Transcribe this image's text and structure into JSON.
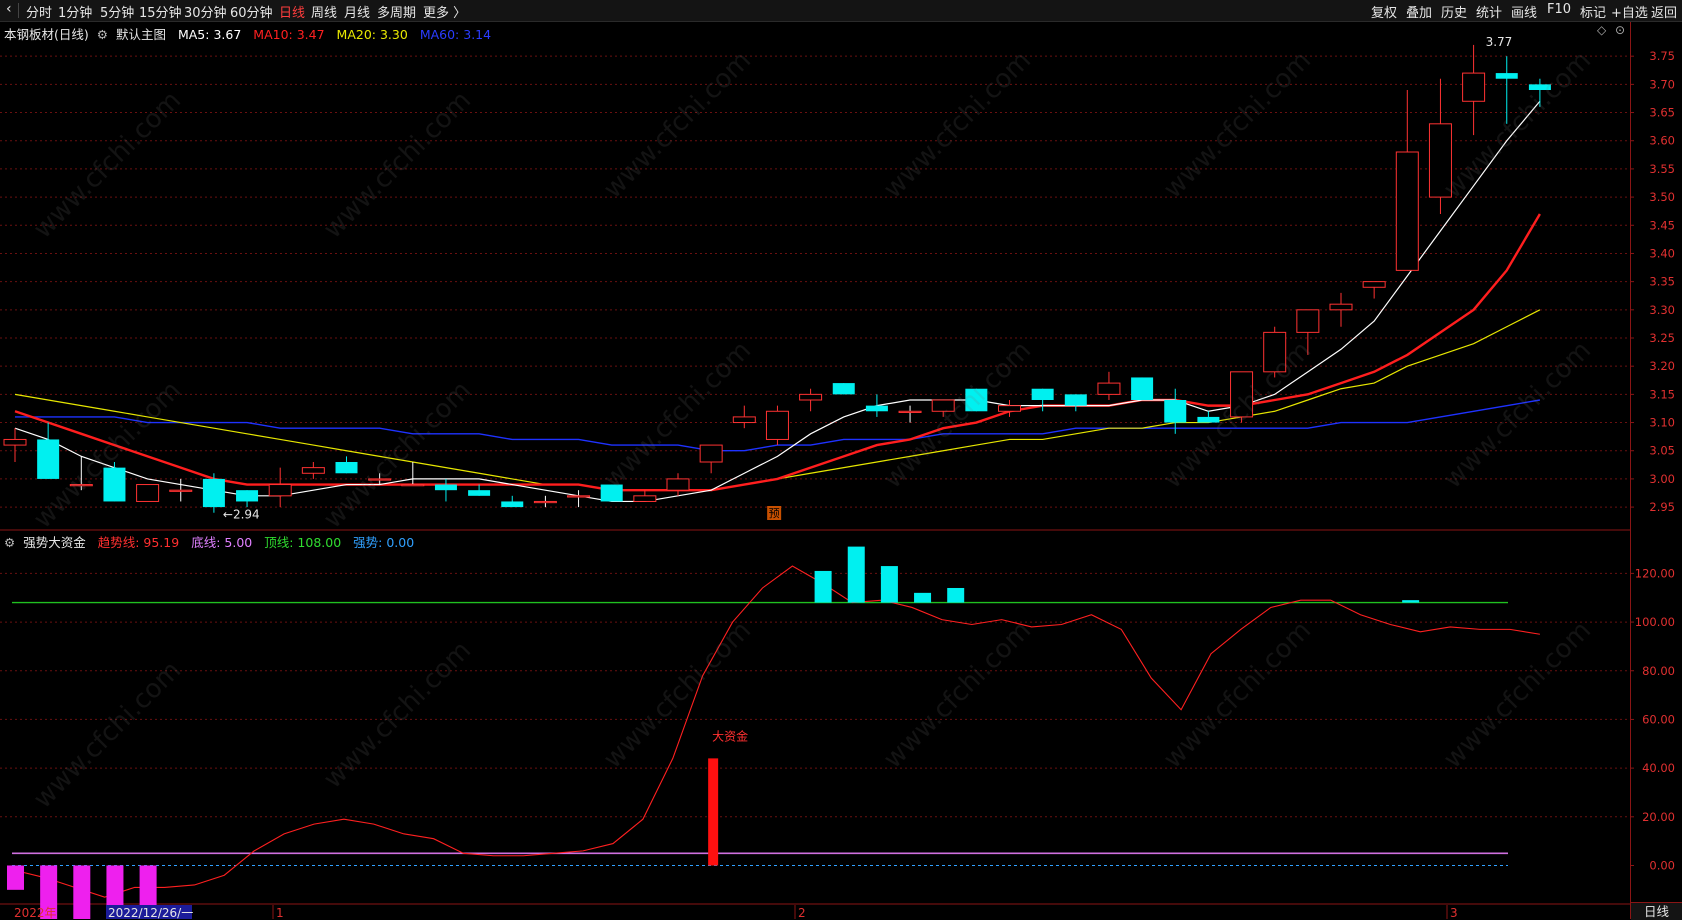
{
  "toolbar": {
    "back_icon": "back-arrow-icon",
    "periods": [
      "分时",
      "1分钟",
      "5分钟",
      "15分钟",
      "30分钟",
      "60分钟",
      "日线",
      "周线",
      "月线",
      "多周期",
      "更多 〉"
    ],
    "active_period": "日线",
    "right_buttons": [
      "复权",
      "叠加",
      "历史",
      "统计",
      "画线",
      "F10",
      "标记",
      "+自选",
      "返回"
    ]
  },
  "main_panel": {
    "stock_label": "本钢板材(日线)",
    "template_label": "默认主图",
    "settings_icon": "gear-icon",
    "ma": [
      {
        "label": "MA5:",
        "value": "3.67",
        "color": "#ffffff"
      },
      {
        "label": "MA10:",
        "value": "3.47",
        "color": "#ff2020"
      },
      {
        "label": "MA20:",
        "value": "3.30",
        "color": "#e8e800"
      },
      {
        "label": "MA60:",
        "value": "3.14",
        "color": "#2a3cff"
      }
    ],
    "high_label": "3.77",
    "low_label": "2.94",
    "low_arrow": "←2.94",
    "pre_marker": "预",
    "y_ticks": [
      "3.75",
      "3.70",
      "3.65",
      "3.60",
      "3.55",
      "3.50",
      "3.45",
      "3.40",
      "3.35",
      "3.30",
      "3.25",
      "3.20",
      "3.15",
      "3.10",
      "3.05",
      "3.00",
      "2.95"
    ],
    "collapse_icon": "diamond-icon"
  },
  "sub_panel": {
    "indicator_name": "强势大资金",
    "items": [
      {
        "label": "趋势线:",
        "value": "95.19",
        "color": "#ff3030"
      },
      {
        "label": "底线:",
        "value": "5.00",
        "color": "#e080ff"
      },
      {
        "label": "顶线:",
        "value": "108.00",
        "color": "#30dd30"
      },
      {
        "label": "强势:",
        "value": "0.00",
        "color": "#30a0ff"
      }
    ],
    "annotation": "大资金",
    "y_ticks": [
      "120.00",
      "100.00",
      "80.00",
      "60.00",
      "40.00",
      "20.00",
      "0.00"
    ]
  },
  "x_axis": {
    "year_label": "2022年",
    "cursor_date": "2022/12/26/一",
    "month_labels": [
      "1",
      "2",
      "3"
    ]
  },
  "bottom_tab": "日线",
  "watermark": "www.cfchi.com",
  "colors": {
    "up": "#ff3232",
    "down": "#00f0f0",
    "ma5": "#ffffff",
    "ma10": "#ff1e1e",
    "ma20": "#e6e600",
    "ma60": "#1e32ff",
    "grid": "#6a1010"
  },
  "chart_data": {
    "type": "candlestick",
    "price_range": [
      2.92,
      3.8
    ],
    "indicator_range": [
      -15,
      137
    ],
    "candles": [
      {
        "o": 3.06,
        "h": 3.09,
        "l": 3.03,
        "c": 3.07
      },
      {
        "o": 3.07,
        "h": 3.1,
        "l": 3.0,
        "c": 3.0
      },
      {
        "o": 2.99,
        "h": 3.04,
        "l": 2.98,
        "c": 2.99
      },
      {
        "o": 3.02,
        "h": 3.03,
        "l": 2.96,
        "c": 2.96
      },
      {
        "o": 2.96,
        "h": 2.99,
        "l": 2.96,
        "c": 2.99
      },
      {
        "o": 2.98,
        "h": 3.0,
        "l": 2.96,
        "c": 2.98
      },
      {
        "o": 3.0,
        "h": 3.01,
        "l": 2.94,
        "c": 2.95
      },
      {
        "o": 2.98,
        "h": 2.98,
        "l": 2.95,
        "c": 2.96
      },
      {
        "o": 2.97,
        "h": 3.02,
        "l": 2.95,
        "c": 2.99
      },
      {
        "o": 3.01,
        "h": 3.03,
        "l": 3.0,
        "c": 3.02
      },
      {
        "o": 3.03,
        "h": 3.04,
        "l": 3.01,
        "c": 3.01
      },
      {
        "o": 3.0,
        "h": 3.01,
        "l": 2.99,
        "c": 3.0
      },
      {
        "o": 2.99,
        "h": 3.03,
        "l": 2.99,
        "c": 2.99
      },
      {
        "o": 2.99,
        "h": 3.0,
        "l": 2.96,
        "c": 2.98
      },
      {
        "o": 2.98,
        "h": 2.99,
        "l": 2.97,
        "c": 2.97
      },
      {
        "o": 2.96,
        "h": 2.97,
        "l": 2.95,
        "c": 2.95
      },
      {
        "o": 2.96,
        "h": 2.97,
        "l": 2.95,
        "c": 2.96
      },
      {
        "o": 2.97,
        "h": 2.98,
        "l": 2.95,
        "c": 2.97
      },
      {
        "o": 2.99,
        "h": 2.99,
        "l": 2.96,
        "c": 2.96
      },
      {
        "o": 2.96,
        "h": 2.98,
        "l": 2.96,
        "c": 2.97
      },
      {
        "o": 2.98,
        "h": 3.01,
        "l": 2.97,
        "c": 3.0
      },
      {
        "o": 3.03,
        "h": 3.06,
        "l": 3.01,
        "c": 3.06
      },
      {
        "o": 3.1,
        "h": 3.13,
        "l": 3.09,
        "c": 3.11
      },
      {
        "o": 3.07,
        "h": 3.13,
        "l": 3.06,
        "c": 3.12
      },
      {
        "o": 3.14,
        "h": 3.16,
        "l": 3.12,
        "c": 3.15
      },
      {
        "o": 3.17,
        "h": 3.17,
        "l": 3.15,
        "c": 3.15
      },
      {
        "o": 3.13,
        "h": 3.15,
        "l": 3.11,
        "c": 3.12
      },
      {
        "o": 3.12,
        "h": 3.13,
        "l": 3.1,
        "c": 3.12
      },
      {
        "o": 3.12,
        "h": 3.14,
        "l": 3.11,
        "c": 3.14
      },
      {
        "o": 3.16,
        "h": 3.16,
        "l": 3.12,
        "c": 3.12
      },
      {
        "o": 3.12,
        "h": 3.14,
        "l": 3.11,
        "c": 3.13
      },
      {
        "o": 3.16,
        "h": 3.16,
        "l": 3.12,
        "c": 3.14
      },
      {
        "o": 3.15,
        "h": 3.15,
        "l": 3.12,
        "c": 3.13
      },
      {
        "o": 3.15,
        "h": 3.19,
        "l": 3.14,
        "c": 3.17
      },
      {
        "o": 3.18,
        "h": 3.18,
        "l": 3.14,
        "c": 3.14
      },
      {
        "o": 3.14,
        "h": 3.16,
        "l": 3.08,
        "c": 3.1
      },
      {
        "o": 3.11,
        "h": 3.12,
        "l": 3.1,
        "c": 3.1
      },
      {
        "o": 3.11,
        "h": 3.19,
        "l": 3.1,
        "c": 3.19
      },
      {
        "o": 3.19,
        "h": 3.27,
        "l": 3.18,
        "c": 3.26
      },
      {
        "o": 3.26,
        "h": 3.3,
        "l": 3.22,
        "c": 3.3
      },
      {
        "o": 3.3,
        "h": 3.33,
        "l": 3.27,
        "c": 3.31
      },
      {
        "o": 3.34,
        "h": 3.35,
        "l": 3.32,
        "c": 3.35
      },
      {
        "o": 3.37,
        "h": 3.69,
        "l": 3.37,
        "c": 3.58
      },
      {
        "o": 3.5,
        "h": 3.71,
        "l": 3.47,
        "c": 3.63
      },
      {
        "o": 3.67,
        "h": 3.77,
        "l": 3.61,
        "c": 3.72
      },
      {
        "o": 3.72,
        "h": 3.75,
        "l": 3.63,
        "c": 3.71
      },
      {
        "o": 3.7,
        "h": 3.71,
        "l": 3.66,
        "c": 3.69
      }
    ],
    "ma5": [
      3.09,
      3.07,
      3.04,
      3.02,
      3.0,
      2.99,
      2.98,
      2.97,
      2.97,
      2.98,
      2.99,
      2.99,
      3.0,
      3.0,
      3.0,
      2.99,
      2.98,
      2.97,
      2.96,
      2.96,
      2.97,
      2.98,
      3.01,
      3.04,
      3.08,
      3.11,
      3.13,
      3.14,
      3.14,
      3.14,
      3.13,
      3.13,
      3.13,
      3.13,
      3.14,
      3.14,
      3.12,
      3.13,
      3.15,
      3.19,
      3.23,
      3.28,
      3.36,
      3.44,
      3.52,
      3.6,
      3.67
    ],
    "ma10": [
      3.12,
      3.1,
      3.08,
      3.06,
      3.04,
      3.02,
      3.0,
      2.99,
      2.99,
      2.99,
      2.99,
      2.99,
      2.99,
      2.99,
      2.99,
      2.99,
      2.99,
      2.99,
      2.98,
      2.98,
      2.98,
      2.98,
      2.99,
      3.0,
      3.02,
      3.04,
      3.06,
      3.07,
      3.09,
      3.1,
      3.12,
      3.13,
      3.13,
      3.13,
      3.14,
      3.14,
      3.13,
      3.13,
      3.14,
      3.15,
      3.17,
      3.19,
      3.22,
      3.26,
      3.3,
      3.37,
      3.47
    ],
    "ma20": [
      3.15,
      3.14,
      3.13,
      3.12,
      3.11,
      3.1,
      3.09,
      3.08,
      3.07,
      3.06,
      3.05,
      3.04,
      3.03,
      3.02,
      3.01,
      3.0,
      2.99,
      2.99,
      2.98,
      2.98,
      2.98,
      2.98,
      2.99,
      3.0,
      3.01,
      3.02,
      3.03,
      3.04,
      3.05,
      3.06,
      3.07,
      3.07,
      3.08,
      3.09,
      3.09,
      3.1,
      3.1,
      3.11,
      3.12,
      3.14,
      3.16,
      3.17,
      3.2,
      3.22,
      3.24,
      3.27,
      3.3
    ],
    "ma60": [
      3.11,
      3.11,
      3.11,
      3.11,
      3.1,
      3.1,
      3.1,
      3.1,
      3.09,
      3.09,
      3.09,
      3.09,
      3.08,
      3.08,
      3.08,
      3.07,
      3.07,
      3.07,
      3.06,
      3.06,
      3.06,
      3.05,
      3.05,
      3.06,
      3.06,
      3.07,
      3.07,
      3.07,
      3.08,
      3.08,
      3.08,
      3.08,
      3.09,
      3.09,
      3.09,
      3.09,
      3.09,
      3.09,
      3.09,
      3.09,
      3.1,
      3.1,
      3.1,
      3.11,
      3.12,
      3.13,
      3.14
    ],
    "trend": [
      -2,
      -5,
      -9,
      -13,
      -9,
      -9,
      -8,
      -4,
      6,
      13,
      17,
      19,
      17,
      13,
      11,
      5,
      4,
      4,
      5,
      6,
      9,
      19,
      44,
      78,
      100,
      114,
      123,
      116,
      108,
      109,
      106,
      101,
      99,
      101,
      98,
      99,
      103,
      97,
      77,
      64,
      87,
      97,
      106,
      109,
      109,
      103,
      99,
      96,
      98,
      97,
      97,
      95
    ],
    "top_line": 108,
    "bottom_line": 5,
    "strength_bars_cyan": [
      {
        "i": 24,
        "v": 121
      },
      {
        "i": 25,
        "v": 131
      },
      {
        "i": 26,
        "v": 123
      },
      {
        "i": 27,
        "v": 112
      },
      {
        "i": 28,
        "v": 114
      },
      {
        "i": 41,
        "v": 109
      }
    ],
    "strength_bars_magenta": [
      {
        "i": 0,
        "v": -10
      },
      {
        "i": 1,
        "v": -25
      },
      {
        "i": 2,
        "v": -29
      },
      {
        "i": 3,
        "v": -30
      },
      {
        "i": 4,
        "v": -23
      }
    ],
    "big_money_bar": {
      "i": 21,
      "v": 44
    }
  }
}
